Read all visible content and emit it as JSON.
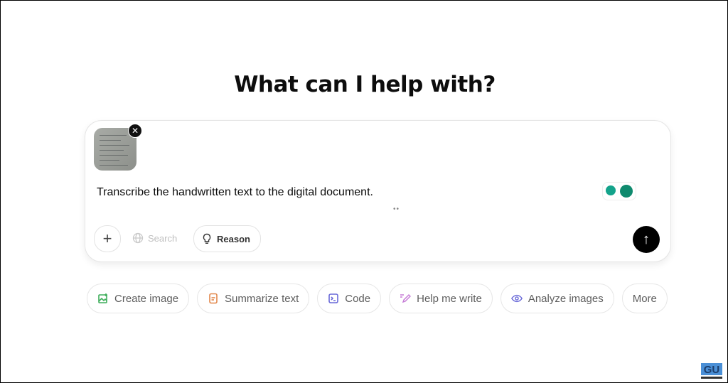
{
  "heading": "What can I help with?",
  "composer": {
    "attachment": {
      "type": "image",
      "remove_icon": "close-icon"
    },
    "prompt_text": "Transcribe the handwritten text to the digital document.",
    "tools": {
      "add_icon": "plus-icon",
      "search_label": "Search",
      "reason_label": "Reason"
    },
    "send_icon": "arrow-up-icon"
  },
  "suggestions": [
    {
      "label": "Create image",
      "icon": "image-icon",
      "color": "#3fae5b"
    },
    {
      "label": "Summarize text",
      "icon": "document-icon",
      "color": "#e2874a"
    },
    {
      "label": "Code",
      "icon": "terminal-icon",
      "color": "#6a6ad8"
    },
    {
      "label": "Help me write",
      "icon": "pen-icon",
      "color": "#c57ad6"
    },
    {
      "label": "Analyze images",
      "icon": "eye-icon",
      "color": "#6a6ad8"
    },
    {
      "label": "More",
      "icon": ""
    }
  ],
  "watermark": "GU"
}
